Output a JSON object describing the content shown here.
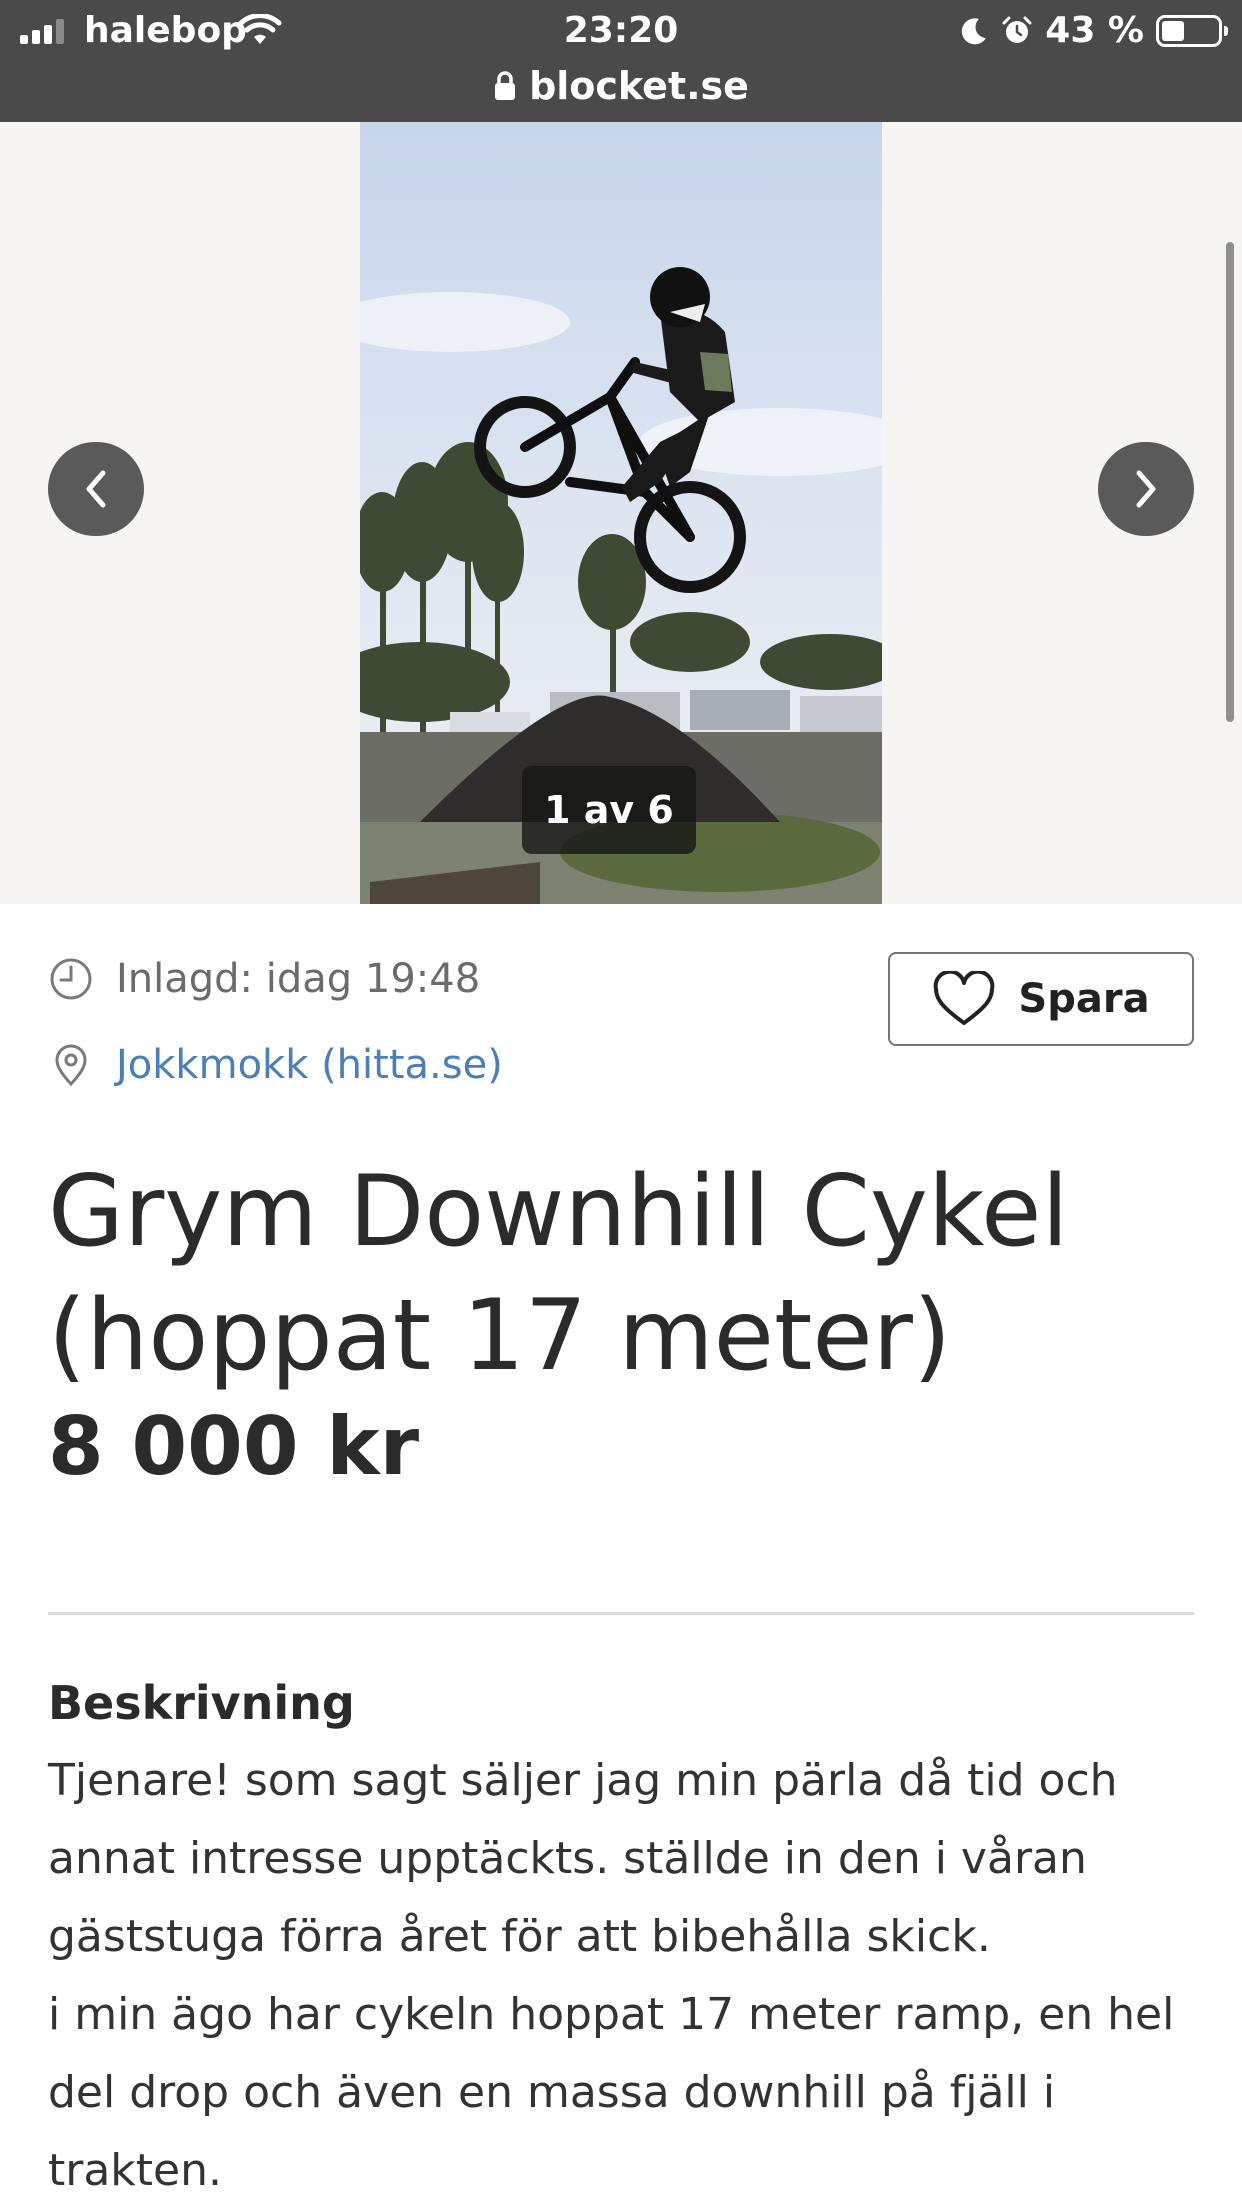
{
  "status_bar": {
    "carrier": "halebop",
    "time": "23:20",
    "battery": "43 %",
    "battery_level": 0.43
  },
  "browser": {
    "url": "blocket.se"
  },
  "gallery": {
    "counter": "1 av 6",
    "prev_icon": "chevron-left-icon",
    "next_icon": "chevron-right-icon"
  },
  "listing": {
    "posted": "Inlagd: idag 19:48",
    "location": "Jokkmokk (hitta.se)",
    "save_label": "Spara",
    "title": "Grym Downhill Cykel (hoppat 17 meter)",
    "price": "8 000 kr"
  },
  "description": {
    "heading": "Beskrivning",
    "paragraphs": [
      "Tjenare! som sagt säljer jag min pärla då tid och annat intresse upptäckts. ställde in den i våran gäststuga förra året för att bibehålla skick.",
      "i min ägo har cykeln hoppat 17 meter ramp, en hel del drop och även en massa downhill på fjäll i trakten."
    ]
  },
  "colors": {
    "status_bg": "#4a4a4a",
    "link": "#4a7fb8",
    "gallery_bg": "#f6f5f3"
  }
}
